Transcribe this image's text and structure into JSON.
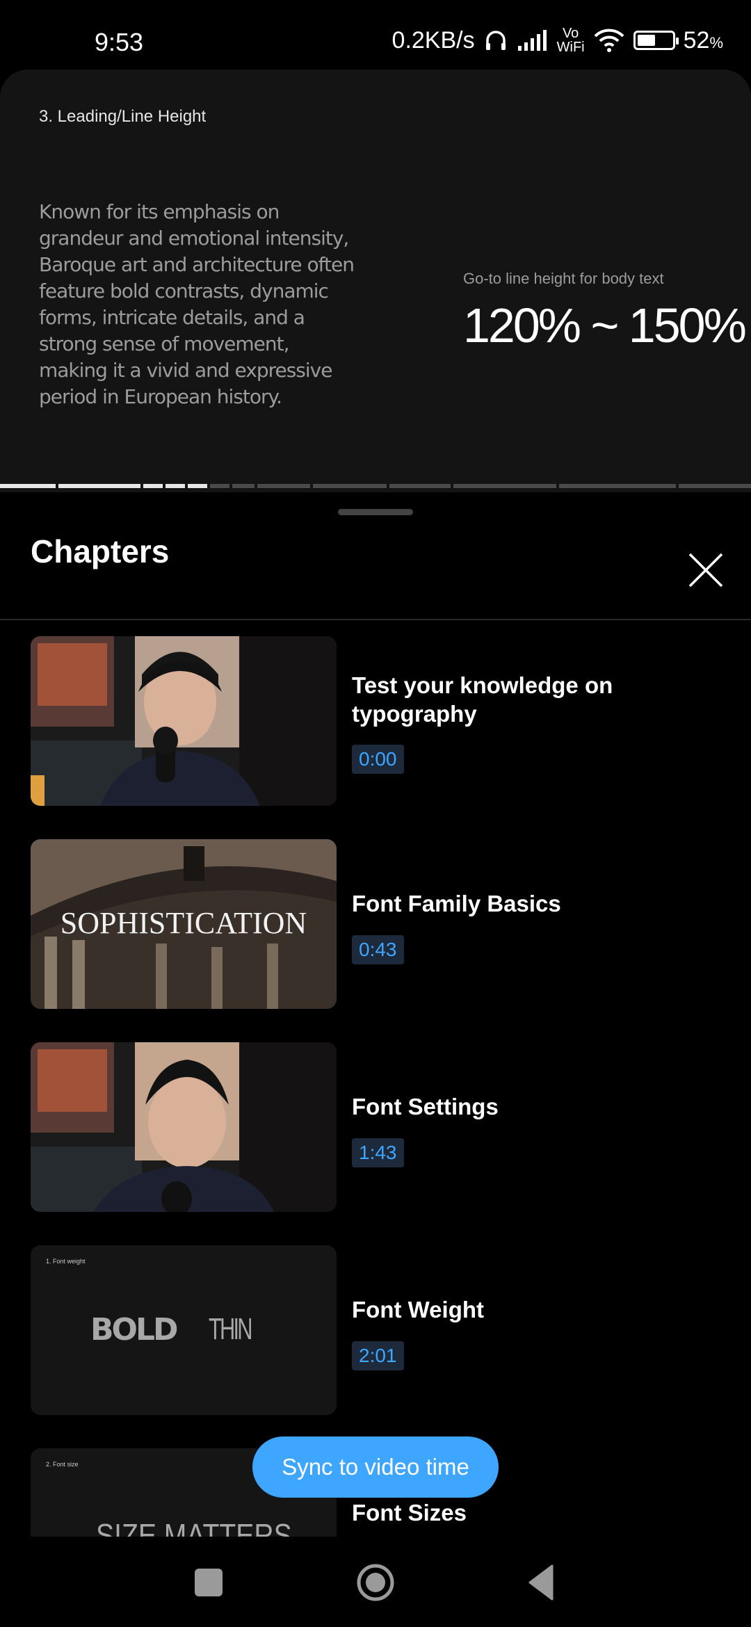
{
  "status_bar": {
    "time": "9:53",
    "network_speed": "0.2KB/s",
    "volte_top": "Vo",
    "volte_bottom": "WiFi",
    "battery": "52",
    "battery_unit": "%",
    "battery_level": 0.52,
    "icons": [
      "headphones-icon",
      "signal-icon",
      "wifi-icon",
      "battery-icon"
    ]
  },
  "video": {
    "slide_heading": "3. Leading/Line Height",
    "slide_body": "Known for its emphasis on grandeur and emotional intensity, Baroque art and architecture often feature bold contrasts, dynamic forms, intricate details, and a strong sense of movement, making it a vivid and expressive period in European history.",
    "slide_caption": "Go-to line height for body text",
    "slide_value": "120% ~ 150%",
    "chapter_progress_segments": 13,
    "segments_watched": 5
  },
  "chapters_panel": {
    "title": "Chapters",
    "close_icon": "close-icon",
    "items": [
      {
        "title": "Test your knowledge on typography",
        "time": "0:00",
        "thumb": "presenter"
      },
      {
        "title": "Font Family Basics",
        "time": "0:43",
        "thumb": "sophistication",
        "thumb_text": "SOPHISTICATION"
      },
      {
        "title": "Font Settings",
        "time": "1:43",
        "thumb": "presenter"
      },
      {
        "title": "Font Weight",
        "time": "2:01",
        "thumb": "weight",
        "thumb_label": "1. Font weight",
        "thumb_left": "BOLD",
        "thumb_right": "THIN"
      },
      {
        "title": "Font Sizes",
        "time": "",
        "thumb": "size",
        "thumb_label": "2. Font size",
        "thumb_text": "SIZE MATTERS"
      }
    ],
    "sync_button": "Sync to video time"
  },
  "nav_bar": {
    "icons": [
      "recents-icon",
      "home-icon",
      "back-icon"
    ]
  },
  "colors": {
    "accent": "#3ea6ff",
    "timestamp_bg": "#1c2a3c",
    "background": "#000000"
  }
}
